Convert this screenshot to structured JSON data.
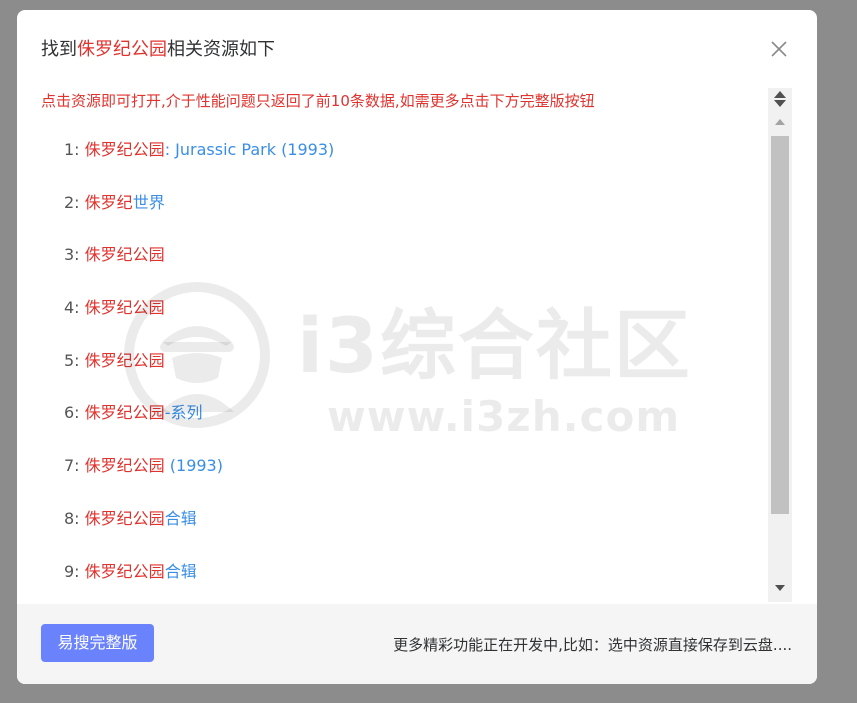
{
  "dialog": {
    "title_prefix": "找到",
    "title_keyword": "侏罗纪公园",
    "title_suffix": "相关资源如下",
    "notice": "点击资源即可打开,介于性能问题只返回了前10条数据,如需更多点击下方完整版按钮"
  },
  "results": [
    {
      "index": "1:",
      "keyword": "侏罗纪公园",
      "suffix": ": Jurassic Park (1993)"
    },
    {
      "index": "2:",
      "keyword": "侏罗纪",
      "suffix": "世界"
    },
    {
      "index": "3:",
      "keyword": "侏罗纪公园",
      "suffix": ""
    },
    {
      "index": "4:",
      "keyword": "侏罗纪公园",
      "suffix": ""
    },
    {
      "index": "5:",
      "keyword": "侏罗纪公园",
      "suffix": ""
    },
    {
      "index": "6:",
      "keyword": "侏罗纪公园",
      "suffix": "-系列"
    },
    {
      "index": "7:",
      "keyword": "侏罗纪公园",
      "suffix": " (1993)"
    },
    {
      "index": "8:",
      "keyword": "侏罗纪公园",
      "suffix": "合辑"
    },
    {
      "index": "9:",
      "keyword": "侏罗纪公园",
      "suffix": "合辑"
    }
  ],
  "footer": {
    "full_button": "易搜完整版",
    "note": "更多精彩功能正在开发中,比如：选中资源直接保存到云盘...."
  },
  "watermark": {
    "name": "i3综合社区",
    "url": "www.i3zh.com"
  },
  "icons": {
    "close": "close-icon",
    "scroll_up": "scroll-up-icon",
    "scroll_down": "scroll-down-icon"
  },
  "colors": {
    "keyword": "#e0332e",
    "suffix": "#3a8ee6",
    "button": "#6a82fb",
    "overlay": "#8c8c8c"
  }
}
